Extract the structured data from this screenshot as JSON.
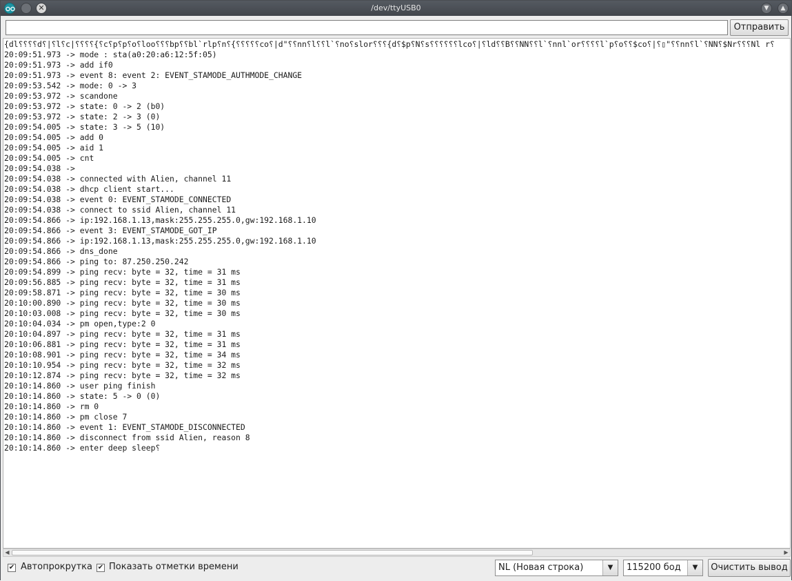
{
  "window": {
    "title": "/dev/ttyUSB0"
  },
  "input": {
    "value": "",
    "send_label": "Отправить"
  },
  "log_lines": [
    "{dl⸮⸮⸮⸮d⸮|⸮l⸮c|⸮⸮⸮⸮{⸮c⸮p⸮p⸮o⸮loo⸮⸮⸮bp⸮⸮bl`rlp⸮n⸮{⸮⸮⸮⸮⸮co⸮|d\"⸮⸮nn⸮l⸮⸮l`⸮no⸮slor⸮⸮⸮{d⸮$p⸮N⸮s⸮⸮⸮⸮⸮⸮lco⸮|⸮ld⸮⸮B⸮⸮NN⸮⸮l`⸮nnl`or⸮⸮⸮⸮l`p⸮o⸮⸮$co⸮|⸮▯\"⸮⸮nn⸮l`⸮NN⸮$Nr⸮⸮⸮Nl r⸮",
    "20:09:51.973 -> mode : sta(a0:20:a6:12:5f:05)",
    "20:09:51.973 -> add if0",
    "20:09:51.973 -> event 8: event 2: EVENT_STAMODE_AUTHMODE_CHANGE",
    "20:09:53.542 -> mode: 0 -> 3",
    "20:09:53.972 -> scandone",
    "20:09:53.972 -> state: 0 -> 2 (b0)",
    "20:09:53.972 -> state: 2 -> 3 (0)",
    "20:09:54.005 -> state: 3 -> 5 (10)",
    "20:09:54.005 -> add 0",
    "20:09:54.005 -> aid 1",
    "20:09:54.005 -> cnt",
    "20:09:54.038 -> ",
    "20:09:54.038 -> connected with Alien, channel 11",
    "20:09:54.038 -> dhcp client start...",
    "20:09:54.038 -> event 0: EVENT_STAMODE_CONNECTED",
    "20:09:54.038 -> connect to ssid Alien, channel 11",
    "20:09:54.866 -> ip:192.168.1.13,mask:255.255.255.0,gw:192.168.1.10",
    "20:09:54.866 -> event 3: EVENT_STAMODE_GOT_IP",
    "20:09:54.866 -> ip:192.168.1.13,mask:255.255.255.0,gw:192.168.1.10",
    "20:09:54.866 -> dns_done",
    "20:09:54.866 -> ping to: 87.250.250.242",
    "20:09:54.899 -> ping recv: byte = 32, time = 31 ms",
    "20:09:56.885 -> ping recv: byte = 32, time = 31 ms",
    "20:09:58.871 -> ping recv: byte = 32, time = 30 ms",
    "20:10:00.890 -> ping recv: byte = 32, time = 30 ms",
    "20:10:03.008 -> ping recv: byte = 32, time = 30 ms",
    "20:10:04.034 -> pm open,type:2 0",
    "20:10:04.897 -> ping recv: byte = 32, time = 31 ms",
    "20:10:06.881 -> ping recv: byte = 32, time = 31 ms",
    "20:10:08.901 -> ping recv: byte = 32, time = 34 ms",
    "20:10:10.954 -> ping recv: byte = 32, time = 32 ms",
    "20:10:12.874 -> ping recv: byte = 32, time = 32 ms",
    "20:10:14.860 -> user ping finish",
    "20:10:14.860 -> state: 5 -> 0 (0)",
    "20:10:14.860 -> rm 0",
    "20:10:14.860 -> pm close 7",
    "20:10:14.860 -> event 1: EVENT_STAMODE_DISCONNECTED",
    "20:10:14.860 -> disconnect from ssid Alien, reason 8",
    "20:10:14.860 -> enter deep sleep⸮"
  ],
  "bottom": {
    "autoscroll_label": "Автопрокрутка",
    "autoscroll_checked": true,
    "timestamps_label": "Показать отметки времени",
    "timestamps_checked": true,
    "line_ending": "NL (Новая строка)",
    "baud": "115200 бод",
    "clear_label": "Очистить вывод"
  },
  "icons": {
    "app": "arduino-icon",
    "minimize": "minimize-icon",
    "close": "close-icon",
    "rollup": "chevron-down-icon",
    "maximize": "chevron-up-icon"
  },
  "colors": {
    "titlebar": "#4b4f55",
    "app_icon": "#1d95a4"
  }
}
